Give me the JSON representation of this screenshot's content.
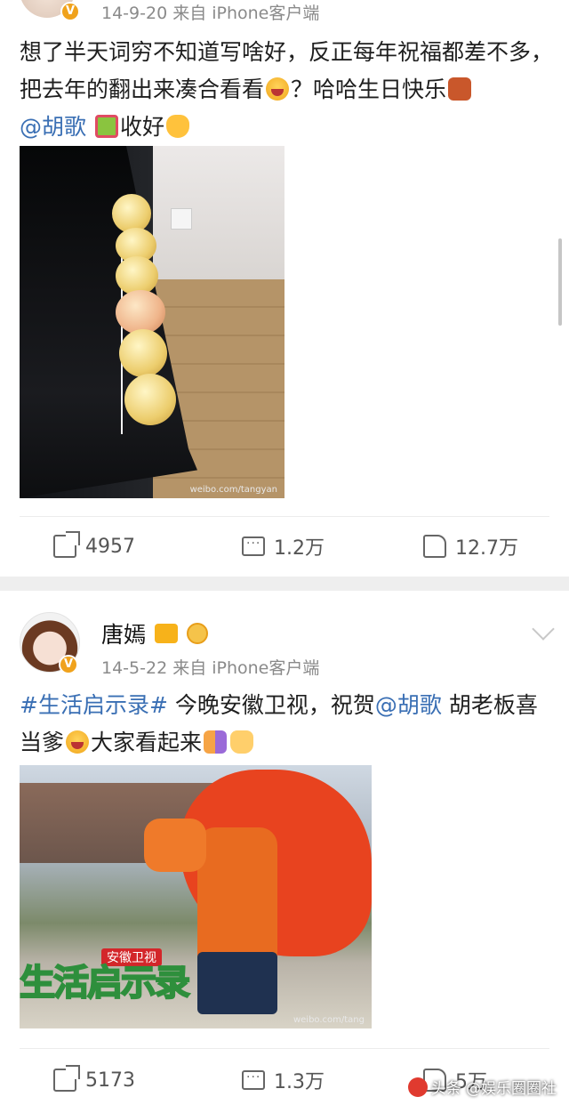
{
  "post1": {
    "meta": "14-9-20  来自 iPhone客户端",
    "text_a": "想了半天词穷不知道写啥好，反正每年祝福都差不多，把去年的翻出来凑合看看",
    "text_b": "？哈哈生日快乐",
    "mention": "@胡歌",
    "text_c": "收好",
    "photo_watermark": "weibo.com/tangyan",
    "actions": {
      "repost": "4957",
      "comment": "1.2万",
      "like": "12.7万"
    }
  },
  "post2": {
    "user": "唐嫣",
    "meta": "14-5-22  来自 iPhone客户端",
    "hashtag": "#生活启示录#",
    "text_a": " 今晚安徽卫视，祝贺",
    "mention": "@胡歌",
    "text_b": " 胡老板喜当爹",
    "text_c": "大家看起来",
    "photo_title": "生活启示录",
    "photo_channel": "安徽卫视",
    "photo_watermark": "weibo.com/tang",
    "actions": {
      "repost": "5173",
      "comment": "1.3万",
      "like": "5万"
    }
  },
  "watermark": "头条 @娱乐圈圈社",
  "colors": {
    "link": "#3a6fb4",
    "badge": "#f0a21c",
    "separator": "#eeeeee"
  },
  "icons": [
    "verified-v-icon",
    "repost-icon",
    "comment-icon",
    "like-icon",
    "chevron-down-icon",
    "crown-icon"
  ]
}
